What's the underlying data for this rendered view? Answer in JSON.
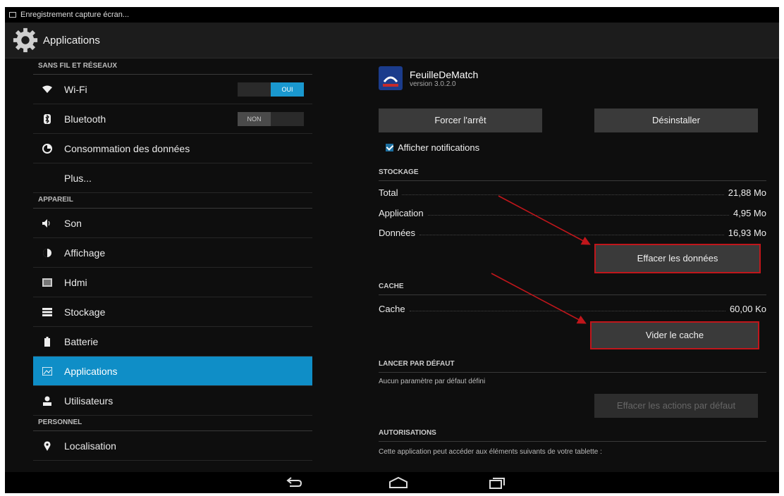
{
  "statusbar": {
    "title": "Enregistrement capture écran..."
  },
  "actionbar": {
    "title": "Applications"
  },
  "settings": {
    "sections": [
      "SANS FIL ET RÉSEAUX",
      "APPAREIL",
      "PERSONNEL"
    ],
    "items": [
      {
        "label": "Wi-Fi",
        "toggle": "OUI"
      },
      {
        "label": "Bluetooth",
        "toggle": "NON"
      },
      {
        "label": "Consommation des données"
      },
      {
        "label": "Plus..."
      },
      {
        "label": "Son"
      },
      {
        "label": "Affichage"
      },
      {
        "label": "Hdmi"
      },
      {
        "label": "Stockage"
      },
      {
        "label": "Batterie"
      },
      {
        "label": "Applications"
      },
      {
        "label": "Utilisateurs"
      },
      {
        "label": "Localisation"
      }
    ]
  },
  "app": {
    "name": "FeuilleDeMatch",
    "version": "version 3.0.2.0",
    "force_stop": "Forcer l'arrêt",
    "uninstall": "Désinstaller",
    "show_notifications": "Afficher notifications",
    "storage_header": "STOCKAGE",
    "storage": [
      {
        "label": "Total",
        "value": "21,88 Mo"
      },
      {
        "label": "Application",
        "value": "4,95 Mo"
      },
      {
        "label": "Données",
        "value": "16,93 Mo"
      }
    ],
    "clear_data": "Effacer les données",
    "cache_header": "CACHE",
    "cache": {
      "label": "Cache",
      "value": "60,00 Ko"
    },
    "clear_cache": "Vider le cache",
    "launch_header": "LANCER PAR DÉFAUT",
    "launch_text": "Aucun paramètre par défaut défini",
    "clear_defaults": "Effacer les actions par défaut",
    "perm_header": "AUTORISATIONS",
    "perm_text": "Cette application peut accéder aux éléments suivants de votre tablette :"
  },
  "colors": {
    "accent": "#0f8ec7",
    "highlight": "#c0161b"
  }
}
